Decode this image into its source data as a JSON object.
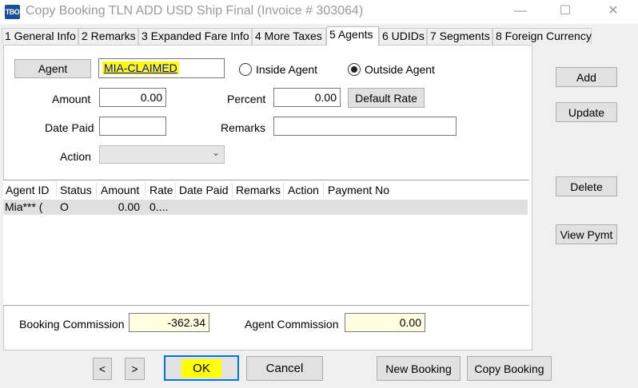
{
  "window": {
    "icon_text": "TBO",
    "title": "Copy Booking TLN ADD USD  Ship Final (Invoice # 303064)",
    "controls": {
      "minimize": "—",
      "maximize": "☐",
      "close": "✕"
    }
  },
  "tabs": [
    {
      "label": "1 General Info"
    },
    {
      "label": "2 Remarks"
    },
    {
      "label": "3 Expanded Fare Info"
    },
    {
      "label": "4 More Taxes"
    },
    {
      "label": "5 Agents"
    },
    {
      "label": "6 UDIDs"
    },
    {
      "label": "7 Segments"
    },
    {
      "label": "8 Foreign Currency"
    }
  ],
  "active_tab": "5 Agents",
  "form": {
    "agent_button": "Agent",
    "agent_value": "MIA-CLAIMED",
    "inside_agent_label": "Inside Agent",
    "outside_agent_label": "Outside Agent",
    "selected_agent_type": "Outside Agent",
    "amount_label": "Amount",
    "amount_value": "0.00",
    "percent_label": "Percent",
    "percent_value": "0.00",
    "default_rate_button": "Default Rate",
    "date_paid_label": "Date Paid",
    "date_paid_value": "",
    "remarks_label": "Remarks",
    "remarks_value": "",
    "action_label": "Action",
    "action_value": ""
  },
  "grid": {
    "columns": [
      "Agent ID",
      "Status",
      "Amount",
      "Rate",
      "Date Paid",
      "Remarks",
      "Action",
      "Payment No"
    ],
    "rows": [
      {
        "agent_id": "Mia*** (",
        "status": "O",
        "amount": "0.00",
        "rate": "0....",
        "date_paid": "",
        "remarks": "",
        "action": "",
        "payment_no": ""
      }
    ]
  },
  "side_buttons": {
    "add": "Add",
    "update": "Update",
    "delete": "Delete",
    "view_pymt": "View Pymt"
  },
  "totals": {
    "booking_commission_label": "Booking Commission",
    "booking_commission_value": "-362.34",
    "agent_commission_label": "Agent Commission",
    "agent_commission_value": "0.00"
  },
  "footer": {
    "prev": "<",
    "next": ">",
    "ok": "OK",
    "cancel": "Cancel",
    "new_booking": "New Booking",
    "copy_booking": "Copy Booking"
  },
  "colors": {
    "highlight": "#ffff00",
    "readonly_field": "#ffffe1",
    "link_text": "#0000cc",
    "title_text": "#9a9a9a"
  }
}
